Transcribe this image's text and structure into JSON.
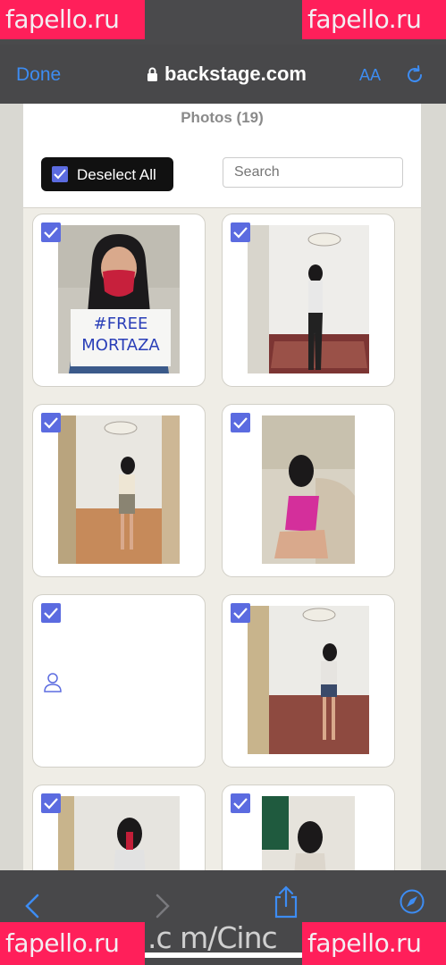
{
  "status_bar": {
    "time": ""
  },
  "watermarks": {
    "brand": "fapello.ru",
    "bottom_url": ".c m/Cinc"
  },
  "nav": {
    "done_label": "Done",
    "url": "backstage.com",
    "text_size_label": "AA"
  },
  "header": {
    "title": "Photos (19)",
    "deselect_label": "Deselect All",
    "search_placeholder": "Search"
  },
  "photos": [
    {
      "id": "photo-1",
      "checked": true,
      "has_image": true
    },
    {
      "id": "photo-2",
      "checked": true,
      "has_image": true
    },
    {
      "id": "photo-3",
      "checked": true,
      "has_image": true
    },
    {
      "id": "photo-4",
      "checked": true,
      "has_image": true
    },
    {
      "id": "photo-5",
      "checked": true,
      "has_image": false,
      "placeholder_icon": "person-icon"
    },
    {
      "id": "photo-6",
      "checked": true,
      "has_image": true
    },
    {
      "id": "photo-7",
      "checked": true,
      "has_image": true
    },
    {
      "id": "photo-8",
      "checked": true,
      "has_image": true
    }
  ],
  "photo_sign_text": "#FREE MORTAZA",
  "colors": {
    "accent": "#3d8cf2",
    "checkbox": "#5b6be0",
    "watermark": "#ff1f5a",
    "toolbar": "#48484a"
  },
  "bottom_toolbar": {
    "icons": [
      "back-icon",
      "forward-icon",
      "share-icon",
      "compass-icon"
    ]
  }
}
